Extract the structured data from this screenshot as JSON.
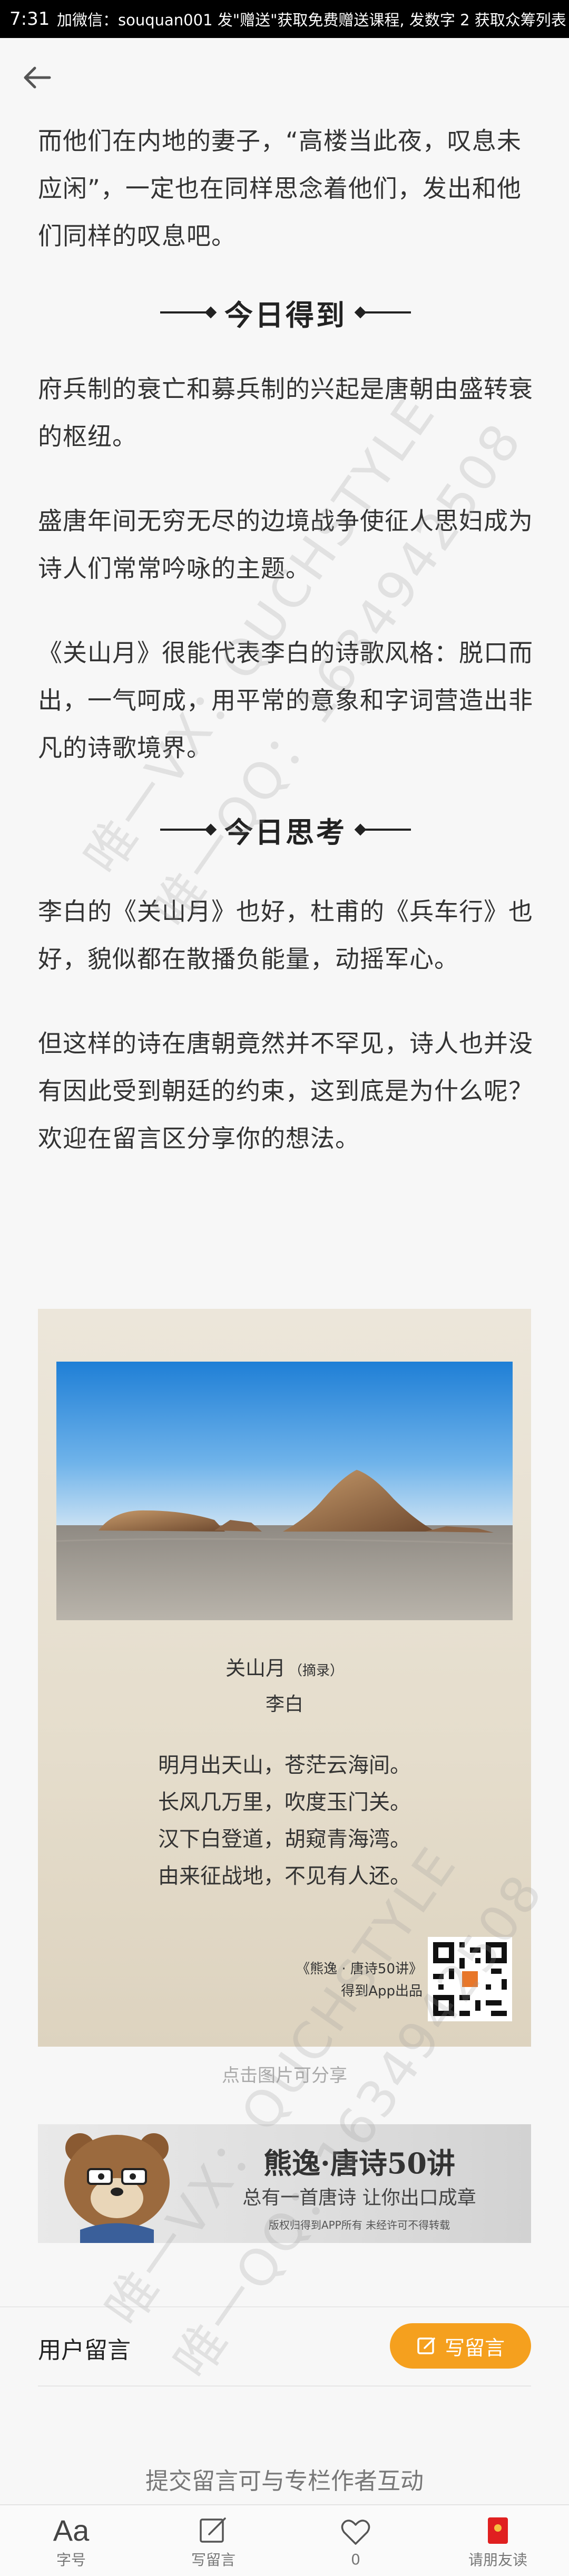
{
  "status_bar": {
    "time": "7:31",
    "marquee": "加微信：souquan001   发\"赠送\"获取免费赠送课程, 发数字 2 获取众筹列表"
  },
  "article": {
    "intro_paragraph": "而他们在内地的妻子，“高楼当此夜，叹息未应闲”，一定也在同样思念着他们，发出和他们同样的叹息吧。",
    "section1_title": "今日得到",
    "section1_paragraphs": [
      "府兵制的衰亡和募兵制的兴起是唐朝由盛转衰的枢纽。",
      "盛唐年间无穷无尽的边境战争使征人思妇成为诗人们常常吟咏的主题。",
      "《关山月》很能代表李白的诗歌风格：脱口而出，一气呵成，用平常的意象和字词营造出非凡的诗歌境界。"
    ],
    "section2_title": "今日思考",
    "section2_paragraphs": [
      "李白的《关山月》也好，杜甫的《兵车行》也好，貌似都在散播负能量，动摇军心。",
      "但这样的诗在唐朝竟然并不罕见，诗人也并没有因此受到朝廷的约束，这到底是为什么呢？欢迎在留言区分享你的想法。"
    ]
  },
  "poem_card": {
    "title": "关山月",
    "title_note": "（摘录）",
    "author": "李白",
    "lines": [
      "明月出天山，苍茫云海间。",
      "长风几万里，吹度玉门关。",
      "汉下白登道，胡窥青海湾。",
      "由来征战地，不见有人还。"
    ],
    "credit_line1": "《熊逸 · 唐诗50讲》",
    "credit_line2": "得到App出品",
    "caption": "点击图片可分享"
  },
  "banner": {
    "title": "熊逸·唐诗50讲",
    "subtitle": "总有一首唐诗 让你出口成章",
    "note": "版权归得到APP所有  未经许可不得转载"
  },
  "comments": {
    "label": "用户留言",
    "write_button": "写留言",
    "hint": "提交留言可与专栏作者互动"
  },
  "bottom_tabs": [
    {
      "icon": "font-size-icon",
      "glyph": "Aa",
      "label": "字号"
    },
    {
      "icon": "edit-icon",
      "label": "写留言"
    },
    {
      "icon": "heart-icon",
      "label": "0"
    },
    {
      "icon": "gift-icon",
      "label": "请朋友读"
    }
  ],
  "watermark": {
    "line1": "唯一VX：QUCHSTYLE",
    "line2": "唯一QQ：1634942508"
  },
  "colors": {
    "accent": "#f5a01e",
    "background": "#f7f7f7",
    "text": "#333333"
  }
}
